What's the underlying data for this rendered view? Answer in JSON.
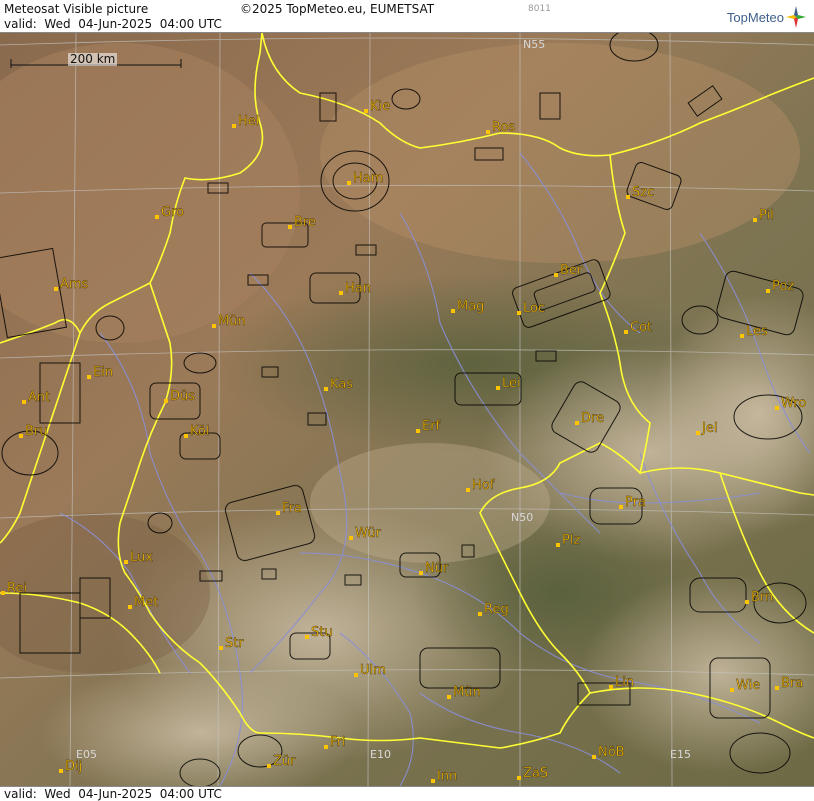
{
  "header": {
    "title": "Meteosat Visible picture",
    "copyright": "©2025 TopMeteo.eu, EUMETSAT",
    "valid": "valid:  Wed  04-Jun-2025  04:00 UTC",
    "code": "8011",
    "logo_text": "TopMeteo"
  },
  "footer": {
    "valid": "valid:  Wed  04-Jun-2025  04:00 UTC"
  },
  "scale": {
    "label": "200 km"
  },
  "grid_labels": [
    {
      "text": "N55",
      "lon": 0.642,
      "lat": 0.014
    },
    {
      "text": "N50",
      "lon": 0.628,
      "lat": 0.643
    },
    {
      "text": "E05",
      "lon": 0.093,
      "lat": 0.958
    },
    {
      "text": "E10",
      "lon": 0.455,
      "lat": 0.958
    },
    {
      "text": "E15",
      "lon": 0.823,
      "lat": 0.958
    }
  ],
  "cities": [
    {
      "name": "Kie",
      "lon": 0.45,
      "lat": 0.103
    },
    {
      "name": "Hel",
      "lon": 0.287,
      "lat": 0.123
    },
    {
      "name": "Ros",
      "lon": 0.599,
      "lat": 0.132
    },
    {
      "name": "Ham",
      "lon": 0.429,
      "lat": 0.199
    },
    {
      "name": "Szc",
      "lon": 0.772,
      "lat": 0.218
    },
    {
      "name": "Gro",
      "lon": 0.193,
      "lat": 0.245
    },
    {
      "name": "Pil",
      "lon": 0.928,
      "lat": 0.248
    },
    {
      "name": "Bre",
      "lon": 0.356,
      "lat": 0.258
    },
    {
      "name": "Ber",
      "lon": 0.683,
      "lat": 0.322
    },
    {
      "name": "Ams",
      "lon": 0.069,
      "lat": 0.34
    },
    {
      "name": "Han",
      "lon": 0.419,
      "lat": 0.345
    },
    {
      "name": "Poz",
      "lon": 0.943,
      "lat": 0.342
    },
    {
      "name": "Mag",
      "lon": 0.557,
      "lat": 0.369
    },
    {
      "name": "Loc",
      "lon": 0.637,
      "lat": 0.372
    },
    {
      "name": "Mün",
      "lon": 0.263,
      "lat": 0.389
    },
    {
      "name": "Cot",
      "lon": 0.769,
      "lat": 0.397
    },
    {
      "name": "Les",
      "lon": 0.912,
      "lat": 0.403
    },
    {
      "name": "Ein",
      "lon": 0.109,
      "lat": 0.457
    },
    {
      "name": "Kas",
      "lon": 0.4,
      "lat": 0.473
    },
    {
      "name": "Lei",
      "lon": 0.612,
      "lat": 0.472
    },
    {
      "name": "Ant",
      "lon": 0.03,
      "lat": 0.49
    },
    {
      "name": "Düs",
      "lon": 0.204,
      "lat": 0.489
    },
    {
      "name": "Dre",
      "lon": 0.709,
      "lat": 0.518
    },
    {
      "name": "Wro",
      "lon": 0.954,
      "lat": 0.498
    },
    {
      "name": "Erf",
      "lon": 0.513,
      "lat": 0.528
    },
    {
      "name": "Bru",
      "lon": 0.026,
      "lat": 0.535
    },
    {
      "name": "Köl",
      "lon": 0.228,
      "lat": 0.535
    },
    {
      "name": "Jel",
      "lon": 0.857,
      "lat": 0.531
    },
    {
      "name": "Hof",
      "lon": 0.575,
      "lat": 0.607
    },
    {
      "name": "Fra",
      "lon": 0.342,
      "lat": 0.637
    },
    {
      "name": "Pra",
      "lon": 0.763,
      "lat": 0.63
    },
    {
      "name": "Wür",
      "lon": 0.431,
      "lat": 0.671
    },
    {
      "name": "Plz",
      "lon": 0.685,
      "lat": 0.68
    },
    {
      "name": "Lux",
      "lon": 0.155,
      "lat": 0.702
    },
    {
      "name": "Nür",
      "lon": 0.517,
      "lat": 0.717
    },
    {
      "name": "Rei",
      "lon": 0.004,
      "lat": 0.744
    },
    {
      "name": "Met",
      "lon": 0.16,
      "lat": 0.762
    },
    {
      "name": "Reg",
      "lon": 0.59,
      "lat": 0.772
    },
    {
      "name": "Brn",
      "lon": 0.918,
      "lat": 0.755
    },
    {
      "name": "Stu",
      "lon": 0.377,
      "lat": 0.802
    },
    {
      "name": "Str",
      "lon": 0.271,
      "lat": 0.817
    },
    {
      "name": "Ulm",
      "lon": 0.437,
      "lat": 0.852
    },
    {
      "name": "Lin",
      "lon": 0.751,
      "lat": 0.868
    },
    {
      "name": "Mün",
      "lon": 0.552,
      "lat": 0.882
    },
    {
      "name": "Wie",
      "lon": 0.899,
      "lat": 0.873
    },
    {
      "name": "Bra",
      "lon": 0.955,
      "lat": 0.87
    },
    {
      "name": "Fri",
      "lon": 0.4,
      "lat": 0.948
    },
    {
      "name": "NöB",
      "lon": 0.73,
      "lat": 0.962
    },
    {
      "name": "Dij",
      "lon": 0.075,
      "lat": 0.98
    },
    {
      "name": "Zür",
      "lon": 0.33,
      "lat": 0.974
    },
    {
      "name": "Inn",
      "lon": 0.532,
      "lat": 0.993
    },
    {
      "name": "ZaS",
      "lon": 0.638,
      "lat": 0.99
    }
  ],
  "colors": {
    "border": "#ffff33",
    "river": "#8a8fd8",
    "airspace": "#000000",
    "city_dot": "#ffc400",
    "city_label": "#ffc400",
    "grid": "#c8c8c8"
  },
  "icons": {
    "logo": "compass-star-icon"
  }
}
